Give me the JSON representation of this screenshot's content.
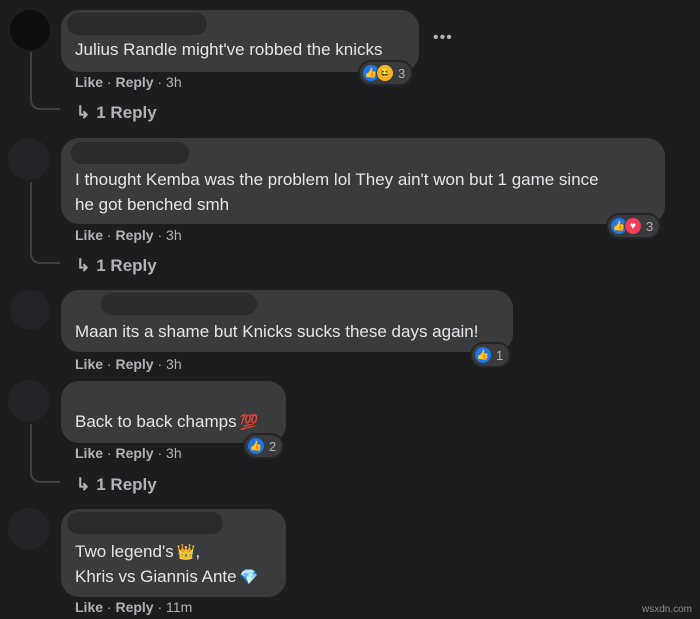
{
  "comments": [
    {
      "text_lines": [
        "Julius Randle might've robbed the knicks"
      ],
      "actions": {
        "like": "Like",
        "sep1": " · ",
        "reply": "Reply",
        "sep2": " · ",
        "time": "3h"
      },
      "reactions": {
        "icons": [
          "like",
          "haha"
        ],
        "count": "3"
      },
      "replies_label": "1 Reply"
    },
    {
      "text_lines": [
        "I thought Kemba was the problem lol They ain't won but 1 game since",
        "he got benched smh"
      ],
      "actions": {
        "like": "Like",
        "sep1": " · ",
        "reply": "Reply",
        "sep2": " · ",
        "time": "3h"
      },
      "reactions": {
        "icons": [
          "like",
          "love"
        ],
        "count": "3"
      },
      "replies_label": "1 Reply"
    },
    {
      "text_lines": [
        "Maan its a shame but Knicks sucks these days again!"
      ],
      "actions": {
        "like": "Like",
        "sep1": " · ",
        "reply": "Reply",
        "sep2": " · ",
        "time": "3h"
      },
      "reactions": {
        "icons": [
          "like"
        ],
        "count": "1"
      },
      "replies_label": ""
    },
    {
      "text_lines": [
        "Back to back champs"
      ],
      "emoji": "💯",
      "actions": {
        "like": "Like",
        "sep1": " · ",
        "reply": "Reply",
        "sep2": " · ",
        "time": "3h"
      },
      "reactions": {
        "icons": [
          "like"
        ],
        "count": "2"
      },
      "replies_label": "1 Reply"
    },
    {
      "text_lines": [
        "Two legend's",
        "Khris vs Giannis Ante"
      ],
      "emojis": [
        "👑",
        "💎"
      ],
      "line1_suffix": ",",
      "actions": {
        "like": "Like",
        "sep1": " · ",
        "reply": "Reply",
        "sep2": " · ",
        "time": "11m"
      }
    }
  ],
  "watermark": "wsxdn.com",
  "colors": {
    "like": "#1877f2",
    "love": "#f33e58",
    "haha": "#f7b125"
  }
}
